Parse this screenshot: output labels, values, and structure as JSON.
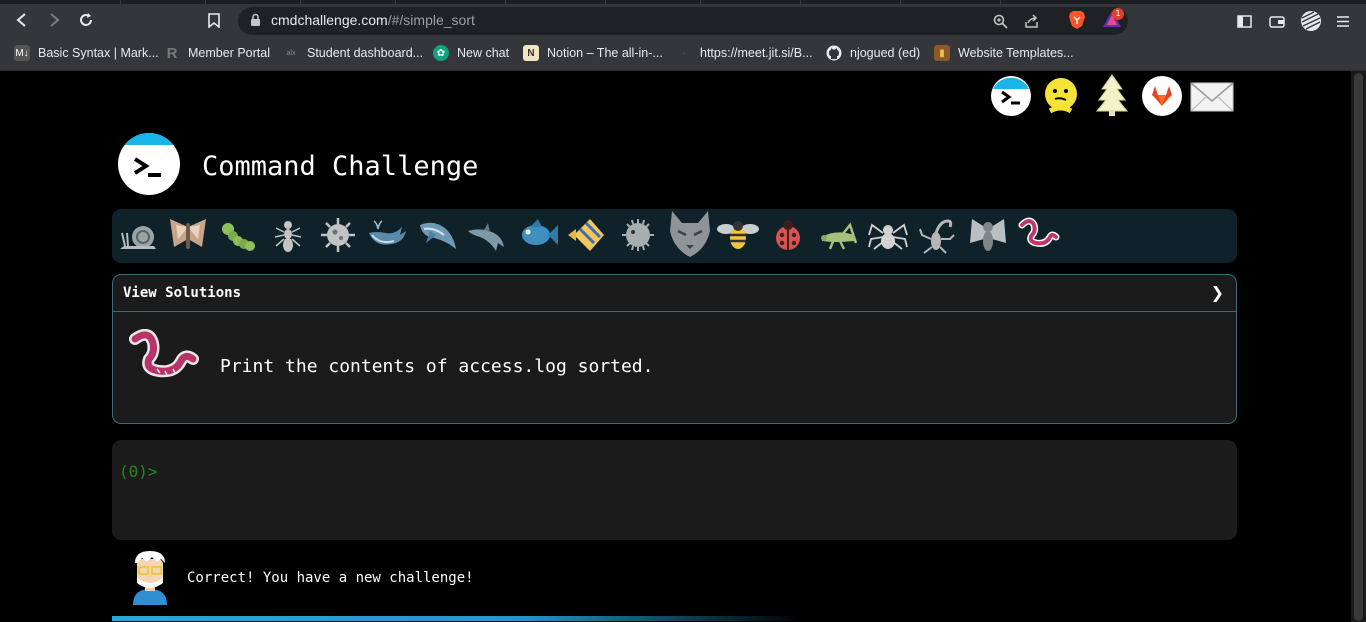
{
  "browser": {
    "url_host": "cmdchallenge.com",
    "url_path": "/#/simple_sort",
    "rewards_badge": "1"
  },
  "bookmarks": [
    {
      "label": "Basic Syntax | Mark...",
      "icon": "markdown-icon"
    },
    {
      "label": "Member Portal",
      "icon": "r-logo-icon"
    },
    {
      "label": "Student dashboard...",
      "icon": "alx-icon"
    },
    {
      "label": "New chat",
      "icon": "openai-icon"
    },
    {
      "label": "Notion – The all-in-...",
      "icon": "notion-icon"
    },
    {
      "label": "https://meet.jit.si/B...",
      "icon": "jitsi-icon"
    },
    {
      "label": "njogued (ed)",
      "icon": "github-icon"
    },
    {
      "label": "Website Templates...",
      "icon": "templates-icon"
    }
  ],
  "header": {
    "title": "Command Challenge"
  },
  "top_links": [
    "cmdchallenge-icon",
    "oops-icon",
    "12days-icon",
    "gitlab-icon",
    "mail-icon"
  ],
  "creatures": [
    "snail",
    "moth",
    "caterpillar",
    "ant",
    "virus",
    "whale",
    "shark",
    "dolphin",
    "fish",
    "angelfish",
    "pufferfish",
    "wolf",
    "bee",
    "ladybug",
    "grasshopper",
    "spider",
    "scorpion",
    "fly",
    "worm"
  ],
  "challenge": {
    "toggle_label": "View Solutions",
    "chevron": "❯",
    "description": "Print the contents of access.log sorted."
  },
  "terminal": {
    "prompt": "(0)",
    "caret": ">"
  },
  "status": {
    "message": "Correct! You have a new challenge!"
  },
  "colors": {
    "background": "#000000",
    "panel": "#1b1b1b",
    "panel_border": "#3e6a77",
    "creature_bar": "#0f2129",
    "prompt_green": "#1f8a1f",
    "accent_blue": "#2aa9d6"
  }
}
